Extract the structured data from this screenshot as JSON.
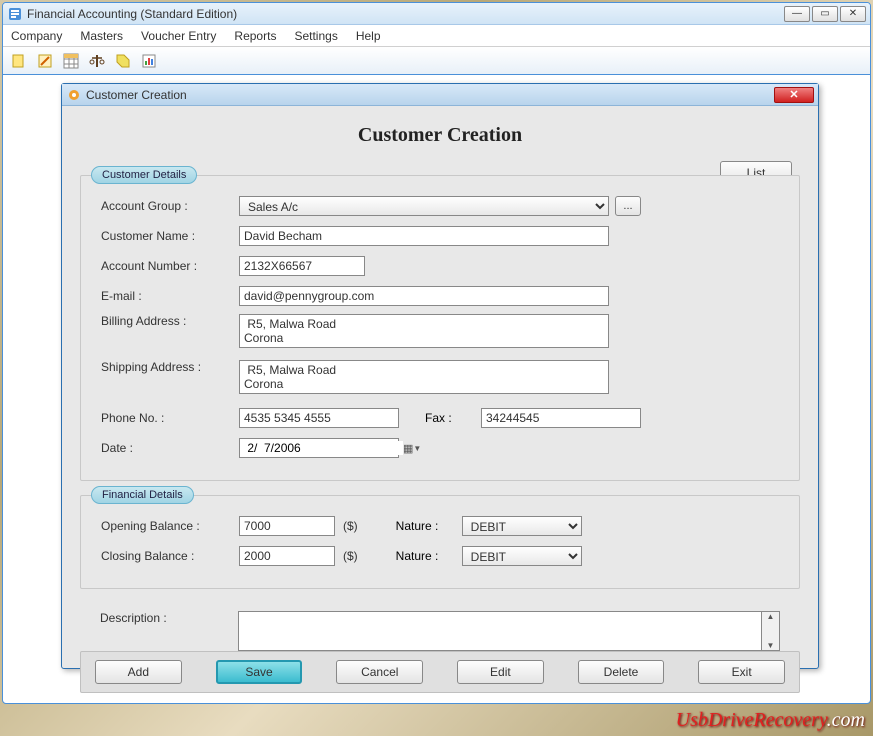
{
  "app": {
    "title": "Financial Accounting (Standard Edition)",
    "menus": [
      "Company",
      "Masters",
      "Voucher Entry",
      "Reports",
      "Settings",
      "Help"
    ]
  },
  "dialog": {
    "title": "Customer Creation",
    "header": "Customer Creation",
    "list_btn": "List",
    "customer_legend": "Customer Details",
    "financial_legend": "Financial Details",
    "labels": {
      "account_group": "Account Group :",
      "customer_name": "Customer Name :",
      "account_number": "Account Number :",
      "email": "E-mail :",
      "billing": "Billing Address :",
      "shipping": "Shipping Address :",
      "phone": "Phone No. :",
      "fax": "Fax :",
      "date": "Date :",
      "opening": "Opening Balance :",
      "closing": "Closing Balance :",
      "nature": "Nature :",
      "currency": "($)",
      "description": "Description :"
    },
    "values": {
      "account_group": "Sales A/c",
      "customer_name": "David Becham",
      "account_number": "2132X66567",
      "email": "david@pennygroup.com",
      "billing": " R5, Malwa Road\nCorona",
      "shipping": " R5, Malwa Road\nCorona",
      "phone": "4535 5345 4555",
      "fax": "34244545",
      "date": " 2/  7/2006",
      "opening": "7000",
      "closing": "2000",
      "nature1": "DEBIT",
      "nature2": "DEBIT",
      "description": ""
    },
    "browse_btn": "...",
    "buttons": {
      "add": "Add",
      "save": "Save",
      "cancel": "Cancel",
      "edit": "Edit",
      "delete": "Delete",
      "exit": "Exit"
    }
  },
  "watermark": {
    "a": "UsbDriveRecovery",
    "b": ".com"
  }
}
